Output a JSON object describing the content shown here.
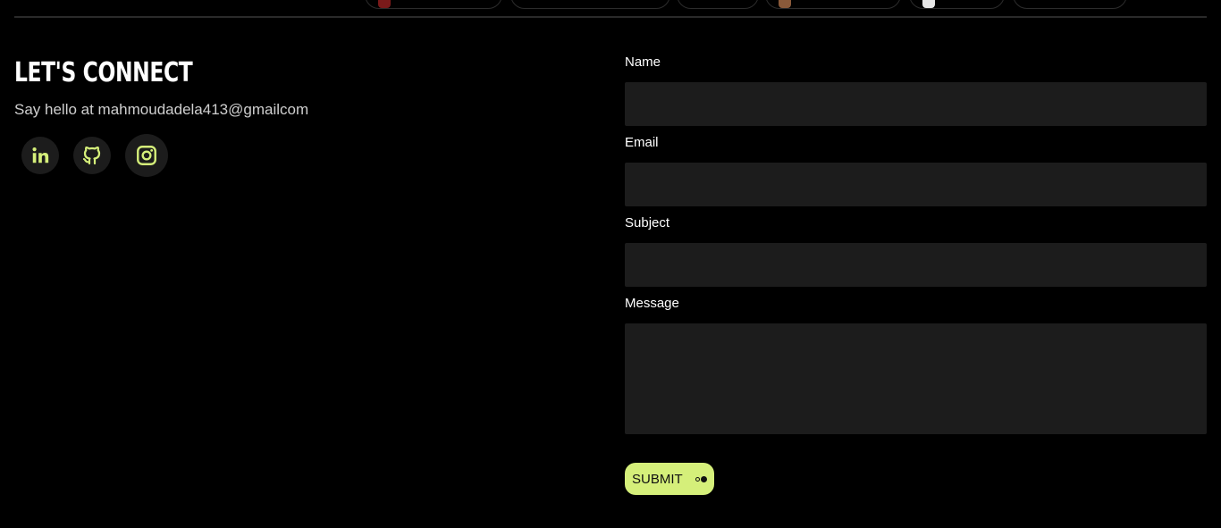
{
  "contact": {
    "title": "LET'S CONNECT",
    "subtitle": "Say hello at mahmoudadela413@gmailcom",
    "socials": [
      {
        "name": "linkedin-icon",
        "color": "#d5ef7a"
      },
      {
        "name": "github-icon",
        "color": "#d5ef7a"
      },
      {
        "name": "instagram-icon",
        "color": "#d5ef7a"
      }
    ]
  },
  "form": {
    "name_label": "Name",
    "email_label": "Email",
    "subject_label": "Subject",
    "message_label": "Message",
    "name_value": "",
    "email_value": "",
    "subject_value": "",
    "message_value": "",
    "submit_label": "SUBMIT"
  },
  "colors": {
    "background": "#000000",
    "field": "#1c1c1c",
    "accent": "#d5ef7a"
  }
}
